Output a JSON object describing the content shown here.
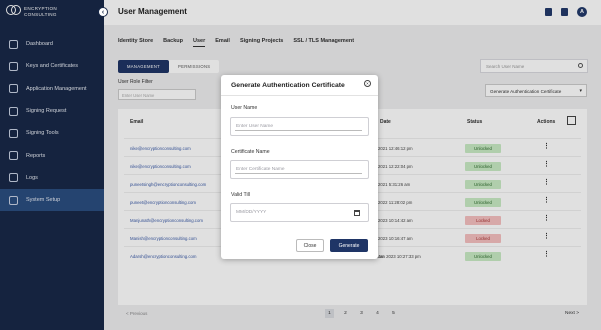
{
  "brand": {
    "line1": "ENCRYPTION",
    "line2": "CONSULTING"
  },
  "sidebar": {
    "items": [
      {
        "label": "Dashboard",
        "icon": "grid-icon"
      },
      {
        "label": "Keys and Certificates",
        "icon": "key-icon"
      },
      {
        "label": "Application Management",
        "icon": "layers-icon"
      },
      {
        "label": "Signing Request",
        "icon": "pen-icon"
      },
      {
        "label": "Signing Tools",
        "icon": "tools-icon"
      },
      {
        "label": "Reports",
        "icon": "chart-icon"
      },
      {
        "label": "Logs",
        "icon": "logs-icon"
      },
      {
        "label": "System Setup",
        "icon": "settings-icon",
        "active": true
      }
    ]
  },
  "header": {
    "title": "User Management",
    "avatar": "A"
  },
  "tabs": [
    "Identity Store",
    "Backup",
    "User",
    "Email",
    "Signing Projects",
    "SSL / TLS Management"
  ],
  "subtabs": [
    "MANAGEMENT",
    "PERMISSIONS"
  ],
  "filter": {
    "label": "User Role Filter",
    "placeholder": "Enter User Name"
  },
  "search": {
    "placeholder": "Search User Name"
  },
  "generate_dropdown": "Generate Authentication Certificate",
  "table": {
    "headers": [
      "Email",
      "Date",
      "Status",
      "Actions"
    ],
    "rows": [
      {
        "email": "nike@encryptionconsulting.com",
        "date": "2021 12:46:12 pm",
        "status": "Unlocked"
      },
      {
        "email": "nike@encryptionconsulting.com",
        "date": "2021 12:22:04 pm",
        "status": "Unlocked"
      },
      {
        "email": "puneetsingh@encryptionconsulting.com",
        "date": "2021 5:31:26 am",
        "status": "Unlocked"
      },
      {
        "email": "puneet@encryptionconsulting.com",
        "date": "2022 11:28:02 pm",
        "status": "Unlocked"
      },
      {
        "email": "Manjunath@encryptionconsulting.com",
        "date": "2023 10:14:42 am",
        "status": "Locked"
      },
      {
        "email": "Manish@encryptionconsulting.com",
        "date": "2023 10:16:47 am",
        "status": "Locked"
      },
      {
        "email": "Adarsh@encryptionconsulting.com",
        "date": "Jan 2023 10:27:33 pm",
        "status": "Unlocked"
      }
    ],
    "under_modal_email": "Adarsh@encryptionconsulting.com"
  },
  "pagination": {
    "prev": "< Previous",
    "pages": [
      "1",
      "2",
      "3",
      "4",
      "5"
    ],
    "current": "1",
    "next": "Next >"
  },
  "modal": {
    "title": "Generate Authentication Certificate",
    "fields": [
      {
        "label": "User Name",
        "placeholder": "Enter User Name"
      },
      {
        "label": "Certificate Name",
        "placeholder": "Enter Certificate Name"
      },
      {
        "label": "Valid Till",
        "placeholder": "MM/DD/YYYY"
      }
    ],
    "close_label": "Close",
    "generate_label": "Generate"
  },
  "colors": {
    "sidebar": "#182848",
    "accent": "#1f3566",
    "unlocked": "#c9ebc4",
    "locked": "#f5c0c0"
  }
}
